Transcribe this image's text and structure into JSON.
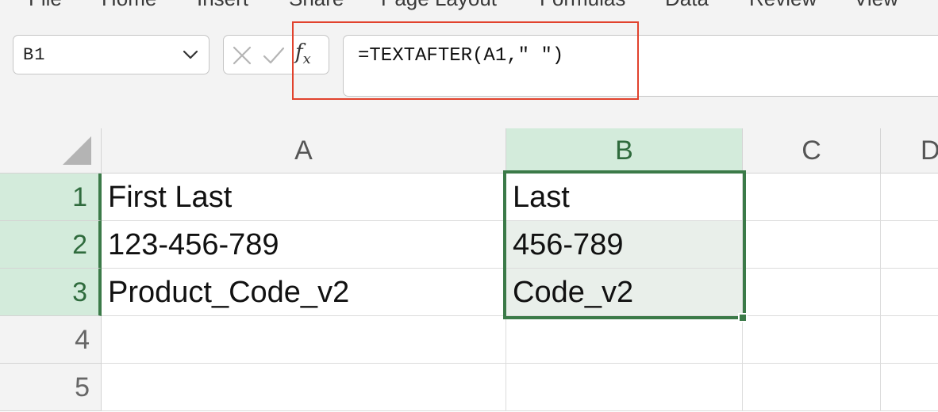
{
  "ribbon": {
    "tabs": [
      "File",
      "Home",
      "Insert",
      "Share",
      "Page Layout",
      "Formulas",
      "Data",
      "Review",
      "View"
    ]
  },
  "name_box": {
    "value": "B1"
  },
  "formula_bar": {
    "value": "=TEXTAFTER(A1,\" \")"
  },
  "fx_button": {
    "label": "f",
    "sub": "x"
  },
  "sheet": {
    "columns": [
      "A",
      "B",
      "C",
      "D"
    ],
    "selected_column": "B",
    "rows": [
      {
        "num": "1",
        "a": "First Last",
        "b": "Last"
      },
      {
        "num": "2",
        "a": "123-456-789",
        "b": "456-789"
      },
      {
        "num": "3",
        "a": "Product_Code_v2",
        "b": "Code_v2"
      },
      {
        "num": "4",
        "a": "",
        "b": ""
      },
      {
        "num": "5",
        "a": "",
        "b": ""
      }
    ]
  },
  "colors": {
    "selection_green": "#3b7a48",
    "header_selected_bg": "#d3ebdb",
    "highlight_red": "#e1422d"
  }
}
